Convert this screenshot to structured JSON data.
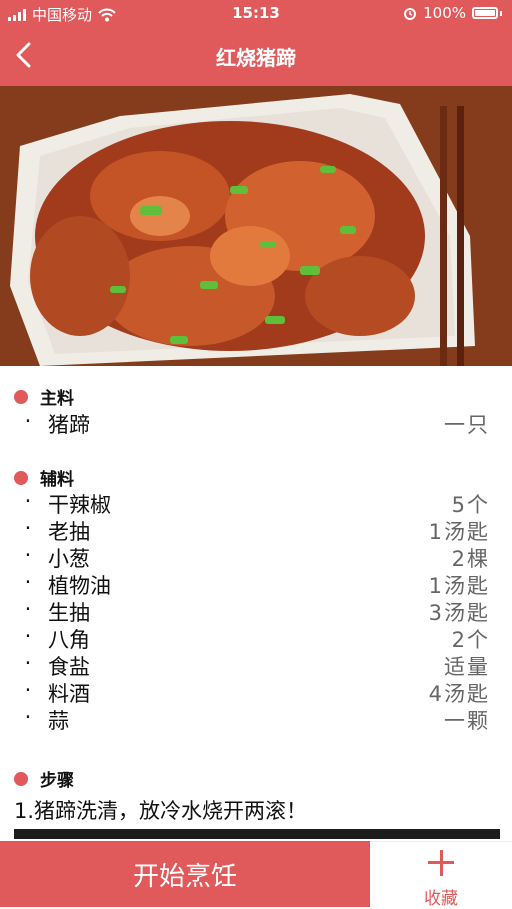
{
  "status_bar": {
    "carrier": "中国移动",
    "time": "15:13",
    "battery": "100%"
  },
  "header": {
    "title": "红烧猪蹄"
  },
  "main_ingredients": {
    "title": "主料",
    "items": [
      {
        "name": "猪蹄",
        "amount": "一只"
      }
    ]
  },
  "aux_ingredients": {
    "title": "辅料",
    "items": [
      {
        "name": "干辣椒",
        "amount": "5个"
      },
      {
        "name": "老抽",
        "amount": "1汤匙"
      },
      {
        "name": "小葱",
        "amount": "2棵"
      },
      {
        "name": "植物油",
        "amount": "1汤匙"
      },
      {
        "name": "生抽",
        "amount": "3汤匙"
      },
      {
        "name": "八角",
        "amount": "2个"
      },
      {
        "name": "食盐",
        "amount": "适量"
      },
      {
        "name": "料酒",
        "amount": "4汤匙"
      },
      {
        "name": "蒜",
        "amount": "一颗"
      }
    ]
  },
  "steps": {
    "title": "步骤",
    "items": [
      "1.猪蹄洗清，放冷水烧开两滚！"
    ]
  },
  "bottom": {
    "start_label": "开始烹饪",
    "favorite_label": "收藏"
  },
  "colors": {
    "accent": "#e05a5c"
  },
  "icons": {
    "back": "chevron-left-icon",
    "favorite": "plus-icon"
  }
}
